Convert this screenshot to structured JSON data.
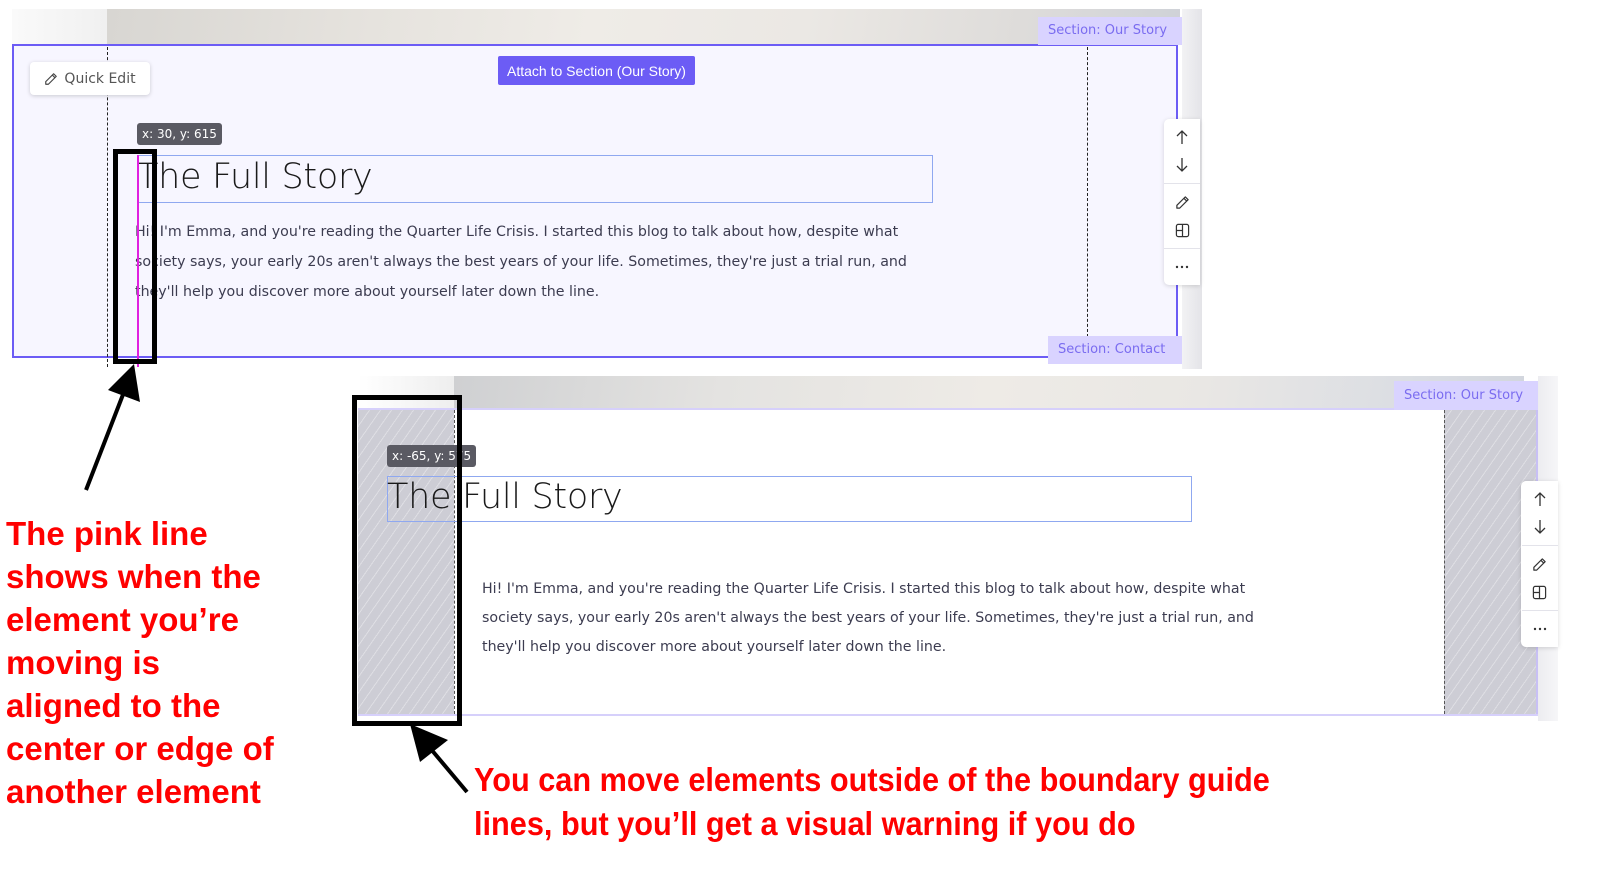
{
  "panels": [
    {
      "section_tag_top": "Section: Our Story",
      "section_tag_bottom": "Section: Contact",
      "quick_edit_label": "Quick Edit",
      "attach_button_label": "Attach to Section (Our Story)",
      "coordinates": "x: 30, y: 615",
      "heading": "The Full Story",
      "paragraph_lines": [
        "Hi! I'm Emma, and you're reading the Quarter Life Crisis. I started this blog to talk about how, despite what",
        "society says, your early 20s aren't always the best years of your life. Sometimes, they're just a trial run, and",
        "they'll help you discover more about yourself later down the line."
      ],
      "toolbar_icons": [
        "arrow-up-icon",
        "arrow-down-icon",
        "pencil-icon",
        "layout-icon",
        "more-icon"
      ]
    },
    {
      "section_tag_top": "Section: Our Story",
      "coordinates": "x: -65, y: 575",
      "heading": "The Full Story",
      "paragraph_lines": [
        "Hi! I'm Emma, and you're reading the Quarter Life Crisis. I started this blog to talk about how, despite what",
        "society says, your early 20s aren't always the best years of your life. Sometimes, they're just a trial run, and",
        "they'll help you discover more about yourself later down the line."
      ],
      "toolbar_icons": [
        "arrow-up-icon",
        "arrow-down-icon",
        "pencil-icon",
        "layout-icon",
        "more-icon"
      ]
    }
  ],
  "annotations": {
    "left_lines": [
      "The pink line",
      "shows when the",
      "element you’re",
      "moving is",
      "aligned to the",
      "center or edge of",
      "another element"
    ],
    "right_lines": [
      "You can move elements outside of the boundary guide",
      "lines, but you’ll get a visual warning if you do"
    ]
  },
  "colors": {
    "accent": "#6c5cf5",
    "section_tag_bg": "#d9d3ff",
    "alignment_guide": "#e020e0",
    "annotation": "#ff0000"
  }
}
